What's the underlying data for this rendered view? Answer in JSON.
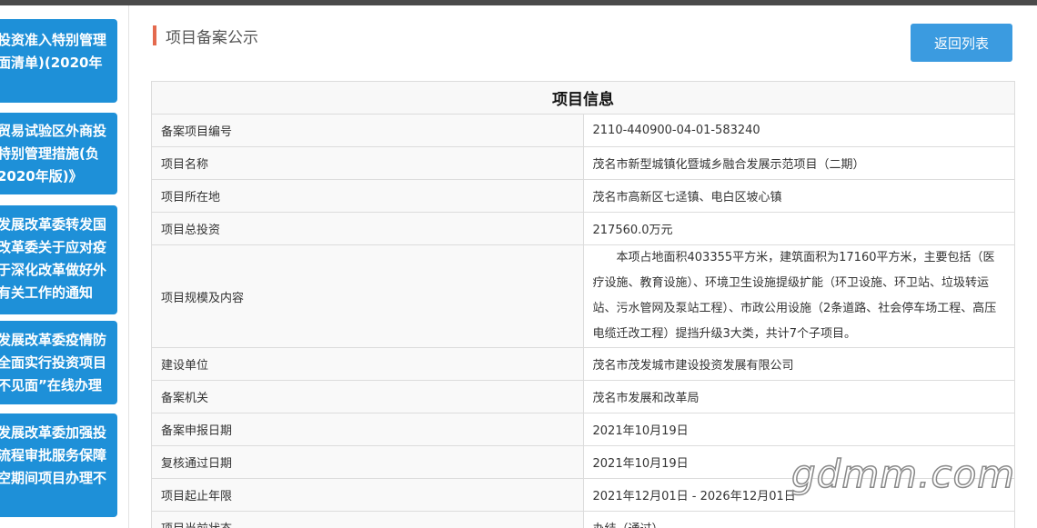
{
  "sidebar": {
    "cards": [
      {
        "lines": [
          "投资准入特别管理",
          "面清单)(2020年"
        ]
      },
      {
        "lines": [
          "贸易试验区外商投",
          "特别管理措施(负",
          "2020年版)》"
        ]
      },
      {
        "lines": [
          "发展改革委转发国",
          "改革委关于应对疫",
          "于深化改革做好外",
          "有关工作的通知"
        ]
      },
      {
        "lines": [
          "发展改革委疫情防",
          "全面实行投资项目",
          "不见面”在线办理"
        ]
      },
      {
        "lines": [
          "发展改革委加强投",
          "流程审批服务保障",
          "空期间项目办理不"
        ]
      }
    ]
  },
  "header": {
    "title": "项目备案公示",
    "back_label": "返回列表"
  },
  "table": {
    "heading": "项目信息",
    "rows": [
      {
        "label": "备案项目编号",
        "value": "2110-440900-04-01-583240"
      },
      {
        "label": "项目名称",
        "value": "茂名市新型城镇化暨城乡融合发展示范项目（二期）"
      },
      {
        "label": "项目所在地",
        "value": "茂名市高新区七迳镇、电白区坡心镇"
      },
      {
        "label": "项目总投资",
        "value": "217560.0万元"
      },
      {
        "label": "项目规模及内容",
        "value": "本项占地面积403355平方米，建筑面积为17160平方米，主要包括（医疗设施、教育设施）、环境卫生设施提级扩能（环卫设施、环卫站、垃圾转运站、污水管网及泵站工程）、市政公用设施（2条道路、社会停车场工程、高压电缆迁改工程）提挡升级3大类，共计7个子项目。"
      },
      {
        "label": "建设单位",
        "value": "茂名市茂发城市建设投资发展有限公司"
      },
      {
        "label": "备案机关",
        "value": "茂名市发展和改革局"
      },
      {
        "label": "备案申报日期",
        "value": "2021年10月19日"
      },
      {
        "label": "复核通过日期",
        "value": "2021年10月19日"
      },
      {
        "label": "项目起止年限",
        "value": "2021年12月01日 - 2026年12月01日"
      },
      {
        "label": "项目当前状态",
        "value": "办结（通过）"
      }
    ]
  },
  "watermark": "gdmm.com",
  "colors": {
    "sidebar_card": "#1e90d8",
    "button": "#3b9be0",
    "title_accent": "#e46a4e",
    "top_bar": "#4a4a4a"
  }
}
